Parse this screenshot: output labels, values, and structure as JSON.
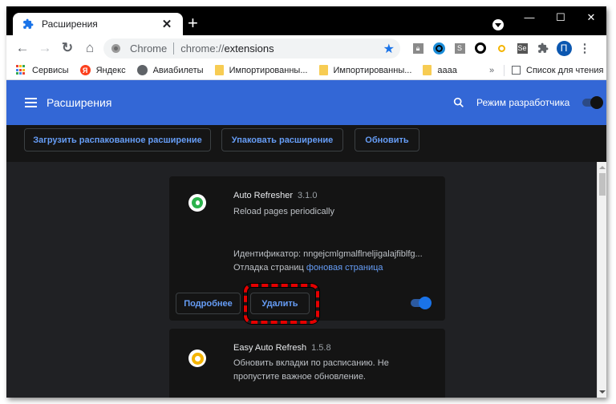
{
  "browser": {
    "tab": {
      "title": "Расширения",
      "icon": "puzzle-icon",
      "close": "✕"
    },
    "new_tab": "+",
    "window_controls": {
      "minimize": "—",
      "maximize": "☐",
      "close": "✕"
    },
    "toolbar": {
      "back": "←",
      "forward": "→",
      "reload": "↻",
      "home": "⌂",
      "omnibox": {
        "label": "Chrome",
        "scheme": "chrome://",
        "path": "extensions",
        "star": "★"
      },
      "extension_icons": [
        "lock-icon",
        "clock-icon",
        "s-icon",
        "ring-icon",
        "yellow-ring-icon",
        "selenium-icon",
        "puzzle-icon"
      ],
      "avatar_letter": "П",
      "menu": "⋮"
    },
    "bookmarks": [
      {
        "label": "Сервисы",
        "icon": "apps-icon"
      },
      {
        "label": "Яндекс",
        "icon": "yandex-icon"
      },
      {
        "label": "Авиабилеты",
        "icon": "globe-icon"
      },
      {
        "label": "Импортированны...",
        "icon": "folder-icon"
      },
      {
        "label": "Импортированны...",
        "icon": "folder-icon"
      },
      {
        "label": "аааа",
        "icon": "folder-icon"
      }
    ],
    "bookmarks_overflow": "»",
    "reading_list": "Список для чтения"
  },
  "extensions_page": {
    "title": "Расширения",
    "developer_mode_label": "Режим разработчика",
    "developer_mode_on": true,
    "actions": {
      "load_unpacked": "Загрузить распакованное расширение",
      "pack": "Упаковать расширение",
      "update": "Обновить"
    },
    "cards": [
      {
        "name": "Auto Refresher",
        "version": "3.1.0",
        "description": "Reload pages periodically",
        "id_label": "Идентификатор: nngejcmlgmalflneljigalajfiblfg...",
        "inspect_label": "Отладка страниц",
        "inspect_link": "фоновая страница",
        "details_button": "Подробнее",
        "remove_button": "Удалить",
        "enabled": true,
        "logo_color": "#2bb24c"
      },
      {
        "name": "Easy Auto Refresh",
        "version": "1.5.8",
        "description": "Обновить вкладки по расписанию. Не пропустите важное обновление.",
        "logo_color": "#f4b400"
      }
    ]
  },
  "colors": {
    "header_blue": "#3367d6",
    "link_blue": "#669df6",
    "highlight_red": "#e50000"
  }
}
